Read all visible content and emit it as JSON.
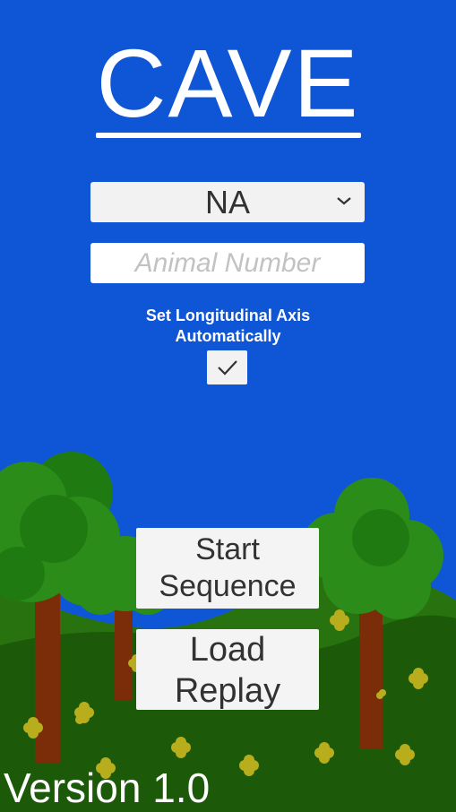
{
  "app": {
    "title": "CAVE"
  },
  "species_dropdown": {
    "selected": "NA"
  },
  "animal_number": {
    "value": "",
    "placeholder": "Animal Number"
  },
  "longitudinal_axis": {
    "label_line1": "Set Longitudinal Axis",
    "label_line2": "Automatically",
    "checked": true
  },
  "buttons": {
    "start_line1": "Start",
    "start_line2": "Sequence",
    "load_line1": "Load",
    "load_line2": "Replay"
  },
  "footer": {
    "version": "Version 1.0"
  },
  "colors": {
    "sky": "#0f56d6",
    "grass": "#1c5a0a",
    "hill": "#28730f",
    "leaves": "#2c8c19",
    "trunk": "#7b2c08",
    "flowers": "#b8ad1c"
  },
  "icons": {
    "dropdown": "chevron-down-icon",
    "checkbox": "checkmark-icon"
  }
}
